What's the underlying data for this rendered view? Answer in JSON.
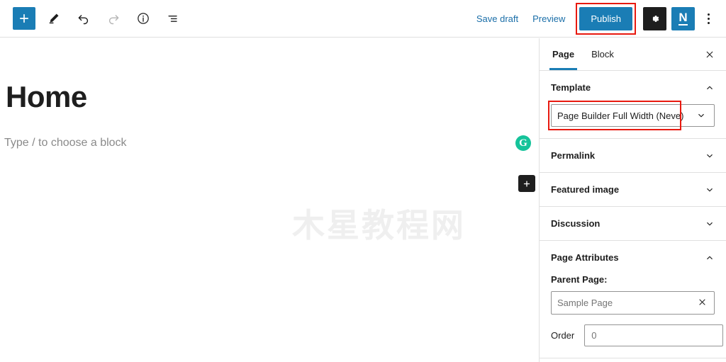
{
  "header": {
    "left_tools": [
      {
        "name": "block-inserter-toggle",
        "icon": "plus-icon",
        "label": "+"
      },
      {
        "name": "edit-mode-pencil",
        "icon": "pencil-icon",
        "label": ""
      },
      {
        "name": "undo-button",
        "icon": "undo-arrow-icon",
        "label": ""
      },
      {
        "name": "redo-button",
        "icon": "redo-arrow-icon",
        "label": ""
      },
      {
        "name": "details-info-button",
        "icon": "info-circle-icon",
        "label": ""
      },
      {
        "name": "list-view-button",
        "icon": "list-view-icon",
        "label": ""
      }
    ],
    "save_draft_label": "Save draft",
    "preview_label": "Preview",
    "publish_label": "Publish",
    "settings_gear_icon": "gear-icon",
    "neve_label": "N",
    "options_menu_icon": "kebab-menu-icon",
    "accent_blue": "#1a7db5",
    "highlight_red": "#e8190f"
  },
  "canvas": {
    "post_title": "Home",
    "block_placeholder": "Type / to choose a block",
    "watermark": "木星教程网",
    "grammarly_icon_label": "G",
    "inserter_label": "+"
  },
  "sidebar": {
    "tabs": [
      {
        "label": "Page",
        "active": true
      },
      {
        "label": "Block",
        "active": false
      }
    ],
    "close_label": "✕",
    "panels": [
      {
        "title": "Template",
        "expanded": true
      },
      {
        "title": "Permalink",
        "expanded": false
      },
      {
        "title": "Featured image",
        "expanded": false
      },
      {
        "title": "Discussion",
        "expanded": false
      },
      {
        "title": "Page Attributes",
        "expanded": true
      }
    ],
    "template": {
      "selected": "Page Builder Full Width (Neve)"
    },
    "page_attributes": {
      "parent_label": "Parent Page:",
      "parent_value": "Sample Page",
      "clear_label": "✕",
      "order_label": "Order",
      "order_value": "0"
    }
  }
}
